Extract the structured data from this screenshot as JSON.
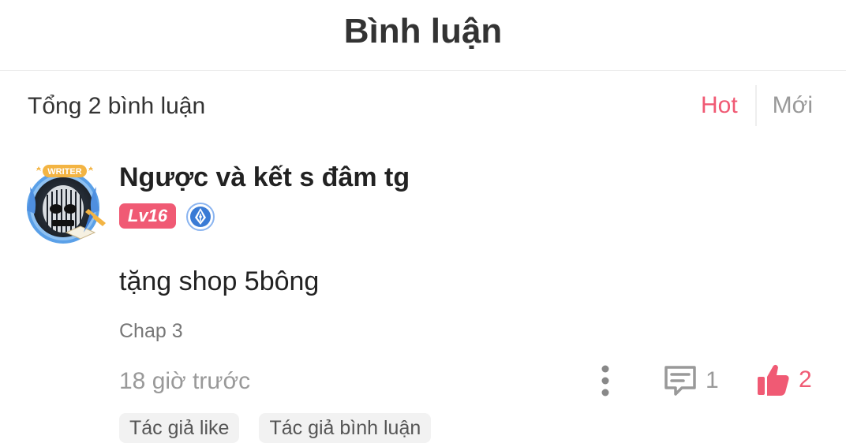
{
  "header": {
    "title": "Bình luận"
  },
  "comments_summary": {
    "total_label": "Tổng 2 bình luận"
  },
  "sort": {
    "hot_label": "Hot",
    "new_label": "Mới",
    "active": "Hot",
    "active_color": "#f05a74"
  },
  "comment": {
    "avatar_badge_text": "WRITER",
    "username": "Ngược và kết s đâm tg",
    "level": "Lv16",
    "writer_badge_icon": "pen-nib-icon",
    "text": "tặng shop 5bông",
    "chapter": "Chap 3",
    "time": "18 giờ trước",
    "reply_count": "1",
    "like_count": "2",
    "liked": true,
    "tags": [
      "Tác giả like",
      "Tác giả bình luận"
    ]
  },
  "colors": {
    "accent": "#f05a74",
    "muted_text": "#999999",
    "writer_badge_blue": "#3a7bd5"
  }
}
